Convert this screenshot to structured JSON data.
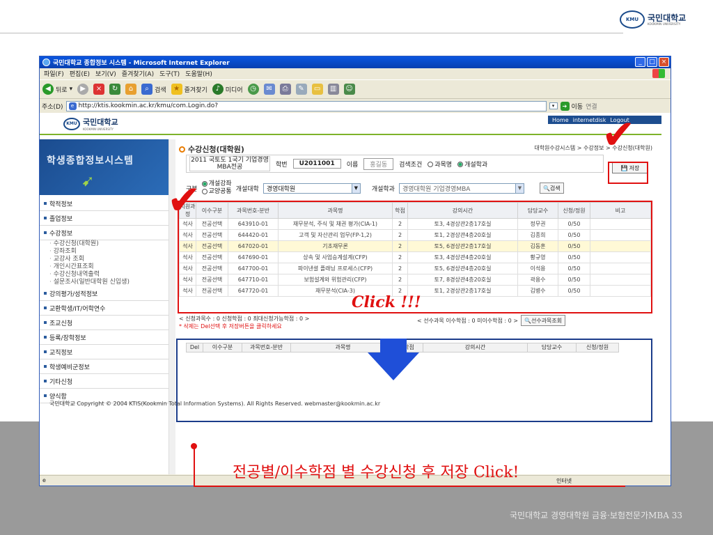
{
  "brand": {
    "logo": "KMU",
    "name_ko": "국민대학교",
    "name_en": "KOOKMIN UNIVERSITY"
  },
  "window": {
    "title": "국민대학교 종합정보 시스템 - Microsoft Internet Explorer",
    "menu": [
      "파일(F)",
      "편집(E)",
      "보기(V)",
      "즐겨찾기(A)",
      "도구(T)",
      "도움말(H)"
    ],
    "toolbar": {
      "back": "뒤로",
      "search": "검색",
      "favorites": "즐겨찾기",
      "media": "미디어"
    },
    "address_label": "주소(D)",
    "url": "http://ktis.kookmin.ac.kr/kmu/com.Login.do?",
    "go": "이동",
    "links": "연결"
  },
  "site": {
    "logo": "KMU",
    "name": "국민대학교",
    "name_en": "KOOKMIN UNIVERSITY",
    "toplinks": [
      "Home",
      "internetdisk",
      "Logout"
    ]
  },
  "sidebar": {
    "title": "학생종합정보시스템",
    "items": [
      "학적정보",
      "졸업정보",
      "수강정보"
    ],
    "subitems": [
      "수강신청(대학원)",
      "강좌조회",
      "교강사 조회",
      "개인시간표조회",
      "수강신청내역출력",
      "설문조사(일반대학원 신입생)"
    ],
    "items2": [
      "강의평가/성적정보",
      "교환학생/IT/어학연수",
      "조교신청",
      "등록/장학정보",
      "교직정보",
      "학생예비군정보",
      "기타신청",
      "양식함"
    ]
  },
  "main": {
    "title": "수강신청(대학원)",
    "breadcrumb": "대학원수강시스템 > 수강정보 > 수강신청(대학원)",
    "program": "2011 국토도 1국기 기업경영MBA전공",
    "student_id_label": "학번",
    "student_id": "U2011001",
    "name_label": "이름",
    "name": "홍길동",
    "search_cond_label": "검색조건",
    "radio_subject": "과목명",
    "radio_dept": "개설학과",
    "save": "저장",
    "filter_label": "구분",
    "radio_open": "개설강좌",
    "radio_liberal": "교양공통",
    "college_label": "개설대학",
    "college": "경영대학원",
    "dept_label": "개설학과",
    "dept": "경영대학원 기업경영MBA",
    "search": "검색"
  },
  "table": {
    "headers": [
      "지원과정",
      "이수구분",
      "과목번호-분반",
      "과목명",
      "학점",
      "강의시간",
      "담당교수",
      "신청/정원",
      "비고"
    ],
    "rows": [
      [
        "석사",
        "전공선택",
        "643910-01",
        "재무분석, 주식 및 채권 평가(CIA-1)",
        "2",
        "토3, 4경상관2층17호실",
        "정무권",
        "0/50",
        ""
      ],
      [
        "석사",
        "전공선택",
        "644420-01",
        "고객 및 자산관리 업무(FP-1,2)",
        "2",
        "토1, 2경상관4층20호실",
        "김종희",
        "0/50",
        ""
      ],
      [
        "석사",
        "전공선택",
        "647020-01",
        "기초재무론",
        "2",
        "토5, 6경상관2층17호실",
        "김동훈",
        "0/50",
        ""
      ],
      [
        "석사",
        "전공선택",
        "647690-01",
        "상속 및 사업승계설계(CFP)",
        "2",
        "토3, 4경상관4층20호실",
        "황규영",
        "0/50",
        ""
      ],
      [
        "석사",
        "전공선택",
        "647700-01",
        "파이낸셜 플래닝 프로세스(CFP)",
        "2",
        "토5, 6경상관4층20호실",
        "이석용",
        "0/50",
        ""
      ],
      [
        "석사",
        "전공선택",
        "647710-01",
        "보험설계와 위험관리(CFP)",
        "2",
        "토7, 8경상관4층20호실",
        "곽용수",
        "0/50",
        ""
      ],
      [
        "석사",
        "전공선택",
        "647720-01",
        "재무분석(CIA-3)",
        "2",
        "토1, 2경상관2층17호실",
        "김병수",
        "0/50",
        ""
      ]
    ],
    "highlight_rows": [
      2
    ]
  },
  "summary": {
    "left": "< 신청과목수 : 0   신청학점 : 0   최대신청가능학점 : 0 >",
    "note": "* 삭제는 Del선택 후 저장버튼을 클릭하세요",
    "right": "< 선수과목 이수학점 : 0   미이수학점 : 0 >",
    "right_btn": "선수과목조회"
  },
  "lower_headers": [
    "Del",
    "이수구분",
    "과목번호-분반",
    "과목명",
    "학점",
    "강의시간",
    "담당교수",
    "신청/정원"
  ],
  "copyright": "국민대학교   Copyright © 2004 KTIS(Kookmin Total Information Systems). All Rights Reserved. webmaster@kookmin.ac.kr",
  "status": "인터넷",
  "annotations": {
    "click": "Click !!!",
    "instruction": "전공별/이수학점 별 수강신청 후 저장 Click!"
  },
  "footer": "국민대학교 경영대학원 금융·보험전문가MBA 33",
  "colors": {
    "annotation_red": "#e01010",
    "blue_box": "#1b3c8a",
    "check_red": "#e01010"
  }
}
